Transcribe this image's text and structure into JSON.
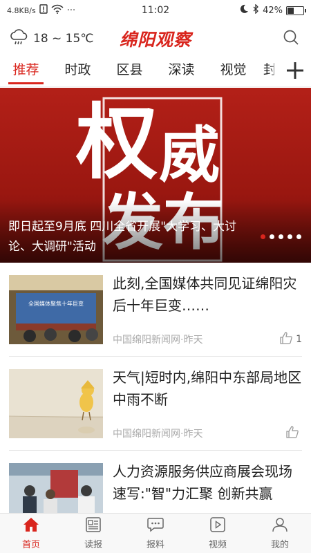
{
  "status_bar": {
    "speed": "4.8KB/s",
    "more": "···",
    "time": "11:02",
    "battery": "42%",
    "battery_level": 0.42
  },
  "header": {
    "weather_icon": "cloud-rain-icon",
    "temperature": "18 ~ 15℃",
    "logo": "绵阳观察",
    "search_icon": "search-icon"
  },
  "tabs": [
    {
      "label": "推荐"
    },
    {
      "label": "时政"
    },
    {
      "label": "区县"
    },
    {
      "label": "深读"
    },
    {
      "label": "视觉"
    },
    {
      "label": "封"
    }
  ],
  "banner": {
    "art_text": [
      "权",
      "威",
      "发",
      "布"
    ],
    "caption": "即日起至9月底 四川全省开展\"大学习、大讨论、大调研\"活动",
    "dot_count": 5,
    "active_dot": 0
  },
  "news": [
    {
      "title": "此刻,全国媒体共同见证绵阳灾后十年巨变……",
      "meta": "中国绵阳新闻网·昨天",
      "likes": "1",
      "thumb_caption": "全国媒体聚焦十年巨变"
    },
    {
      "title": "天气|短时内,绵阳中东部局地区中雨不断",
      "meta": "中国绵阳新闻网·昨天",
      "likes": ""
    },
    {
      "title": "人力资源服务供应商展会现场速写:\"智\"力汇聚 创新共赢",
      "meta": "",
      "likes": ""
    }
  ],
  "bottom_nav": [
    {
      "label": "首页",
      "icon": "home-icon"
    },
    {
      "label": "读报",
      "icon": "newspaper-icon"
    },
    {
      "label": "报料",
      "icon": "chat-bubble-icon"
    },
    {
      "label": "视频",
      "icon": "video-play-icon"
    },
    {
      "label": "我的",
      "icon": "user-icon"
    }
  ],
  "colors": {
    "brand_red": "#d9251d",
    "text": "#222222",
    "meta": "#aaaaaa"
  }
}
